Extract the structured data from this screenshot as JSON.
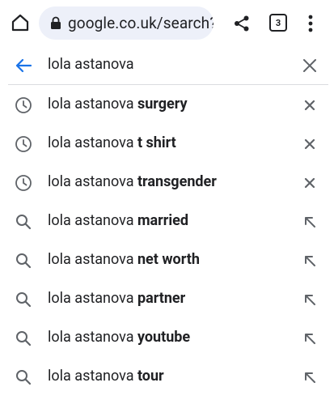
{
  "toolbar": {
    "url": "google.co.uk/search?",
    "tab_count": "3"
  },
  "search": {
    "query": "lola astanova"
  },
  "suggestions": [
    {
      "prefix": "lola astanova ",
      "completion": "surgery",
      "kind": "history",
      "lead_icon": "history-clock-icon",
      "trail_icon": "remove-x-icon"
    },
    {
      "prefix": "lola astanova ",
      "completion": "t shirt",
      "kind": "history",
      "lead_icon": "history-clock-icon",
      "trail_icon": "remove-x-icon"
    },
    {
      "prefix": "lola astanova ",
      "completion": "transgender",
      "kind": "history",
      "lead_icon": "history-clock-icon",
      "trail_icon": "remove-x-icon"
    },
    {
      "prefix": "lola astanova ",
      "completion": "married",
      "kind": "search",
      "lead_icon": "search-icon",
      "trail_icon": "fill-arrow-icon"
    },
    {
      "prefix": "lola astanova ",
      "completion": "net worth",
      "kind": "search",
      "lead_icon": "search-icon",
      "trail_icon": "fill-arrow-icon"
    },
    {
      "prefix": "lola astanova ",
      "completion": "partner",
      "kind": "search",
      "lead_icon": "search-icon",
      "trail_icon": "fill-arrow-icon"
    },
    {
      "prefix": "lola astanova ",
      "completion": "youtube",
      "kind": "search",
      "lead_icon": "search-icon",
      "trail_icon": "fill-arrow-icon"
    },
    {
      "prefix": "lola astanova ",
      "completion": "tour",
      "kind": "search",
      "lead_icon": "search-icon",
      "trail_icon": "fill-arrow-icon"
    }
  ],
  "colors": {
    "accent": "#1a73e8",
    "omnibox_bg": "#edf0f9",
    "icon_gray": "#5f6368",
    "text": "#202124"
  }
}
